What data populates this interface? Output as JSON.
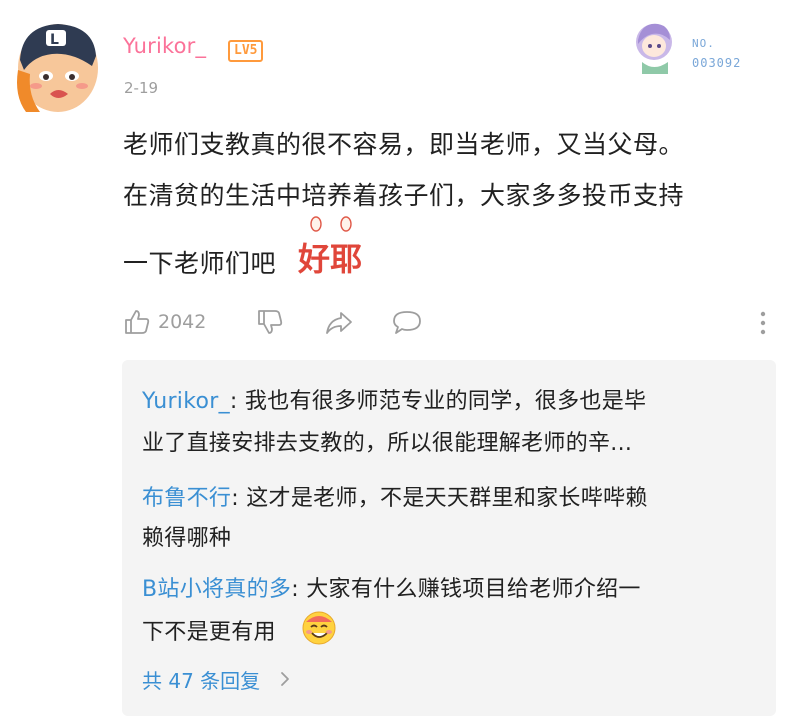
{
  "comment": {
    "username": "Yurikor_",
    "level": "LV5",
    "date": "2-19",
    "text_lines": [
      "老师们支教真的很不容易，即当老师，又当父母。",
      "在清贫的生活中培养着孩子们，大家多多投币支持",
      "一下老师们吧"
    ],
    "emote_text": "好耶",
    "like_count": "2042",
    "fan_badge": {
      "label": "NO.",
      "number": "003092"
    }
  },
  "replies": [
    {
      "name": "Yurikor_",
      "sep": ": ",
      "line1": "我也有很多师范专业的同学，很多也是毕",
      "line2": "业了直接安排去支教的，所以很能理解老师的辛..."
    },
    {
      "name": "布鲁不行",
      "sep": ": ",
      "line1": "这才是老师，不是天天群里和家长哔哔赖",
      "line2": "赖得哪种"
    },
    {
      "name": "B站小将真的多",
      "sep": ": ",
      "line1": "大家有什么赚钱项目给老师介绍一",
      "line2": "下不是更有用"
    }
  ],
  "more_replies": "共 47 条回复",
  "colors": {
    "username_pink": "#fb7299",
    "level_orange": "#ff9a3c",
    "link_blue": "#3a8fd3",
    "muted_gray": "#9e9e9e",
    "reply_bg": "#f4f4f4"
  },
  "icons": [
    "avatar",
    "like-icon",
    "dislike-icon",
    "share-icon",
    "reply-icon",
    "more-vertical-icon",
    "smile-emoji-icon",
    "chevron-right-icon"
  ]
}
